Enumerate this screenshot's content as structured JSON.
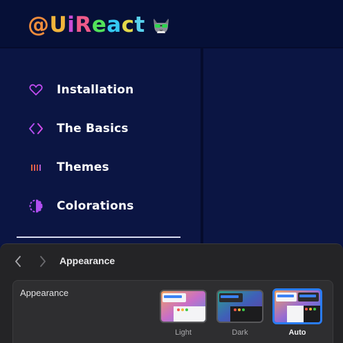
{
  "header": {
    "logo_chars": [
      "@",
      "U",
      "i",
      "R",
      "e",
      "a",
      "c",
      "t"
    ],
    "logo_colors": [
      "#f08c3c",
      "#f0b43c",
      "#c84bd6",
      "#ef5a8a",
      "#52e25a",
      "#35c8f2",
      "#e3d84a",
      "#58d0ec"
    ],
    "logo_icon": "cat-with-sunglasses-icon"
  },
  "sidebar": {
    "items": [
      {
        "label": "Installation",
        "icon": "heart-icon"
      },
      {
        "label": "The Basics",
        "icon": "code-brackets-icon"
      },
      {
        "label": "Themes",
        "icon": "palette-bars-icon"
      },
      {
        "label": "Colorations",
        "icon": "half-circle-contrast-icon"
      }
    ]
  },
  "settings": {
    "title": "Appearance",
    "section_label": "Appearance",
    "options": [
      {
        "label": "Light",
        "selected": false
      },
      {
        "label": "Dark",
        "selected": false
      },
      {
        "label": "Auto",
        "selected": true
      }
    ]
  },
  "colors": {
    "background": "#0a1340",
    "accent_purple": "#b84cf0",
    "selection_blue": "#2a7cf6"
  }
}
